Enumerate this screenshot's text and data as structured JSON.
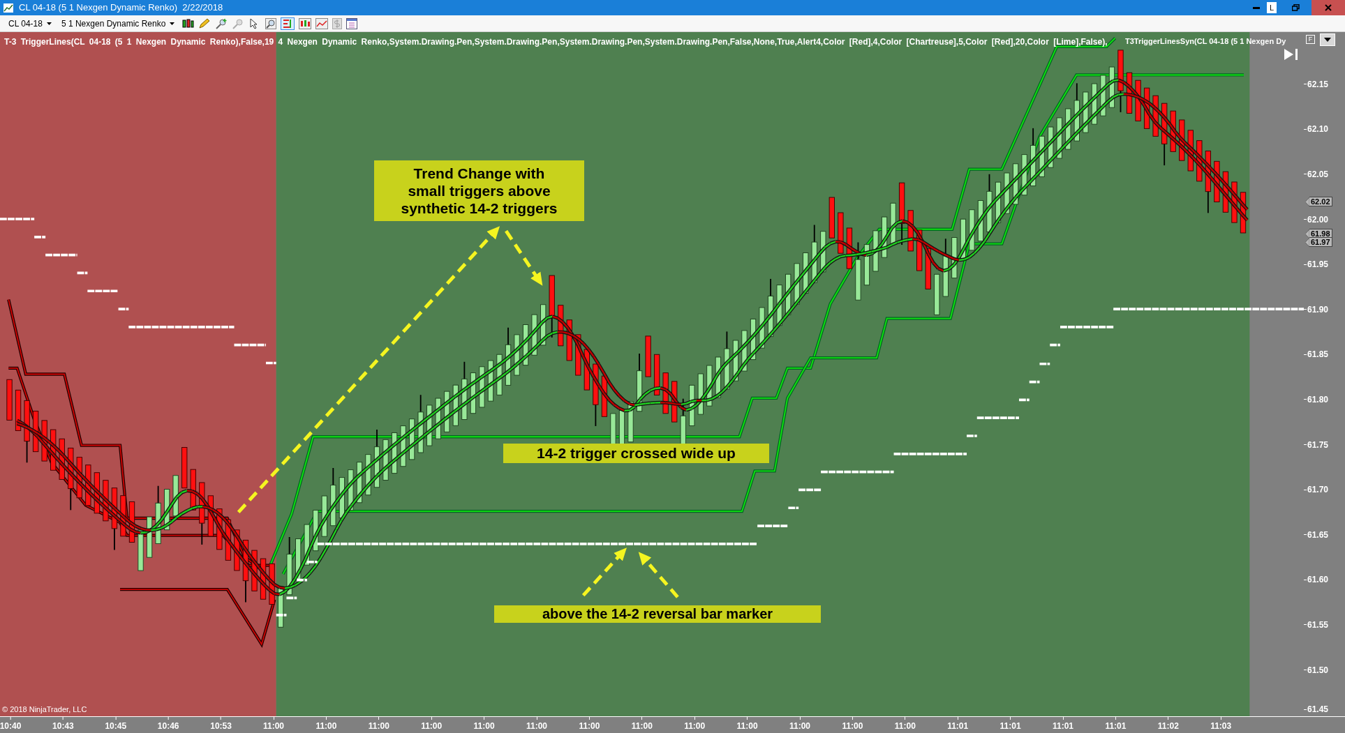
{
  "window": {
    "title": "CL 04-18 (5 1 Nexgen Dynamic Renko)  2/22/2018",
    "badge": "L"
  },
  "toolbar": {
    "instrument": "CL 04-18",
    "bar_type": "5 1 Nexgen Dynamic Renko"
  },
  "chart": {
    "indicator_labels": [
      "T-3 TriggerLines(CL 04-18 (5 1 Nexgen Dynamic Renko),False,19 4 Nexgen Dynamic Renko,System.Drawing.Pen,System.Drawing.Pen,System.Drawing.Pen,System.Drawing.Pen,False,None,True,Alert4,Color [Red],4,Color [Chartreuse],5,Color [Red],20,Color [Lime],False),",
      "T3TriggerLinesSyn(CL 04-18 (5 1 Nexgen Dy"
    ],
    "panel_button": "F",
    "callouts": [
      {
        "lines": [
          "Trend Change with",
          "small triggers above",
          "synthetic 14-2 triggers"
        ]
      },
      {
        "lines": [
          "14-2 trigger crossed wide up"
        ]
      },
      {
        "lines": [
          "above the 14-2 reversal bar marker"
        ]
      }
    ],
    "copyright": "© 2018 NinjaTrader, LLC",
    "price_labels": [
      "62.15",
      "62.10",
      "62.05",
      "62.00",
      "61.95",
      "61.90",
      "61.85",
      "61.80",
      "61.75",
      "61.70",
      "61.65",
      "61.60",
      "61.55",
      "61.50",
      "61.45"
    ],
    "price_markers": [
      "62.02",
      "61.98",
      "61.97"
    ],
    "time_labels": [
      "10:40",
      "10:43",
      "10:45",
      "10:46",
      "10:53",
      "11:00",
      "11:00",
      "11:00",
      "11:00",
      "11:00",
      "11:00",
      "11:00",
      "11:00",
      "11:00",
      "11:00",
      "11:00",
      "11:00",
      "11:00",
      "11:01",
      "11:01",
      "11:01",
      "11:01",
      "11:02",
      "11:03"
    ]
  }
}
